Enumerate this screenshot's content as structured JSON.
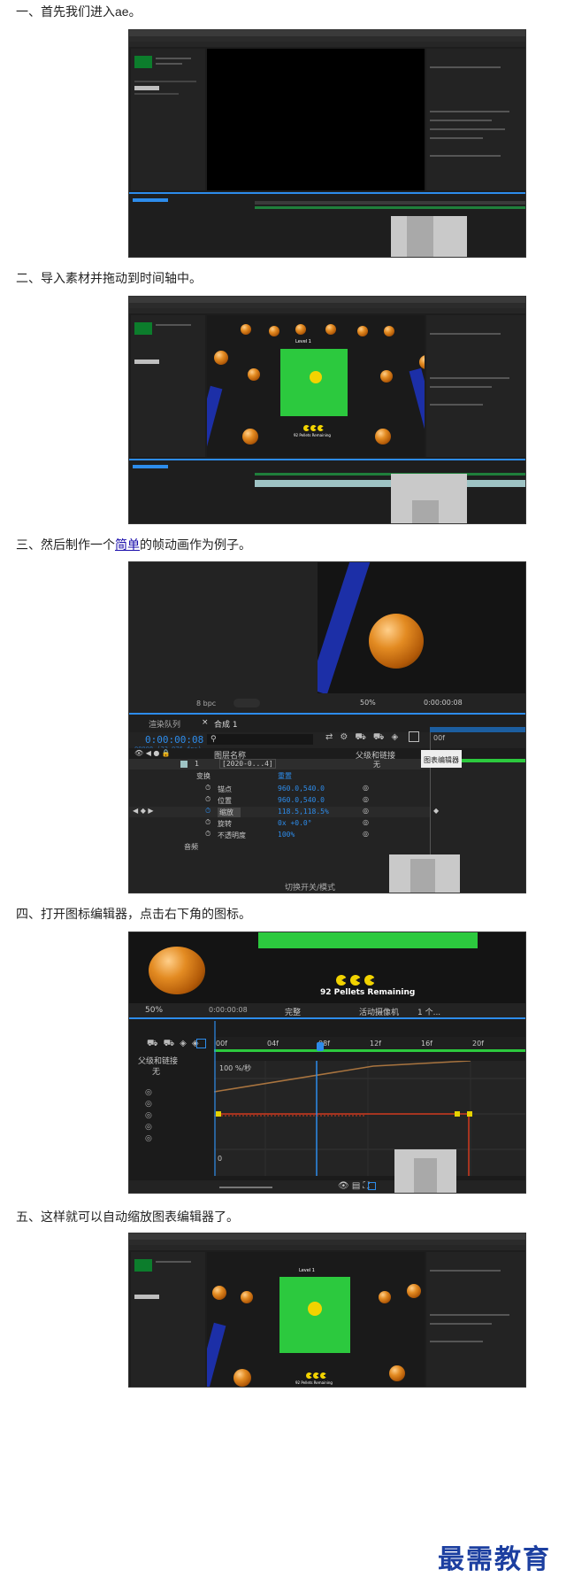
{
  "steps": [
    {
      "text": "一、首先我们进入ae。"
    },
    {
      "text": "二、导入素材并拖动到时间轴中。"
    },
    {
      "prefix": "三、然后制作一个",
      "link": "简单",
      "suffix": "的帧动画作为例子。"
    },
    {
      "text": "四、打开图标编辑器，点击右下角的图标。"
    },
    {
      "text": "五、这样就可以自动缩放图表编辑器了。"
    }
  ],
  "shot3": {
    "bpc": "8 bpc",
    "render_queue": "渲染队列",
    "comp_tab": "合成 1",
    "timecode": "0:00:00:08",
    "timecode_sub": "00008 (23.976 fps)",
    "zoom": "50%",
    "viewer_time": "0:00:00:08",
    "col_layer_name": "图层名称",
    "col_parent": "父级和链接",
    "layer_index": "1",
    "layer_name": "[2020-0...4]",
    "parent_value": "无",
    "transform_label": "变换",
    "reset_label": "重置",
    "props": [
      {
        "name": "锚点",
        "value": "960.0,540.0"
      },
      {
        "name": "位置",
        "value": "960.0,540.0"
      },
      {
        "name": "缩放",
        "value": "118.5,118.5%"
      },
      {
        "name": "旋转",
        "value": "0x +0.0°"
      },
      {
        "name": "不透明度",
        "value": "100%"
      }
    ],
    "audio_label": "音频",
    "switch_label": "切换开关/模式",
    "tooltip": "图表编辑器",
    "ruler_0": "00f"
  },
  "shot4": {
    "pellets": "92 Pellets Remaining",
    "zoom": "50%",
    "viewer_time": "0:00:00:08",
    "quality": "完整",
    "camera": "活动摄像机",
    "view_count": "1 个...",
    "parent_col": "父级和链接",
    "parent_value": "无",
    "ruler": [
      "00f",
      "04f",
      "08f",
      "12f",
      "16f",
      "20f"
    ],
    "graph_top": "100 %/秒",
    "graph_zero": "0"
  },
  "shot2": {
    "level": "Level 1",
    "pellets": "92 Pellets Remaining"
  },
  "shot5": {
    "level": "Level 1",
    "pellets": "92 Pellets Remaining"
  },
  "watermark": "最需教育"
}
